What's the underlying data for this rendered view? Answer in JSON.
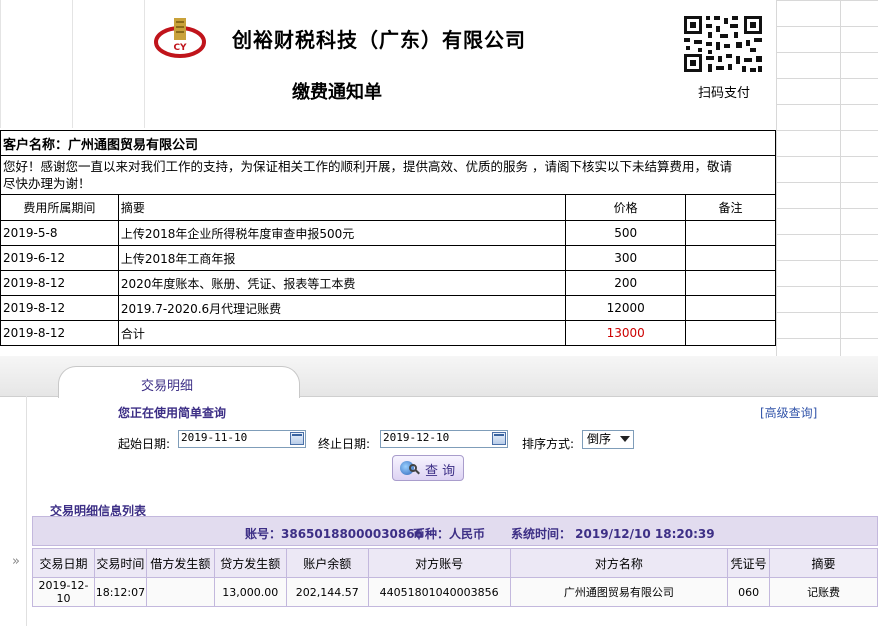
{
  "header": {
    "company": "创裕财税科技（广东）有限公司",
    "doc_title": "缴费通知单",
    "logo_text": "CY",
    "qr_label": "扫码支付"
  },
  "invoice": {
    "customer_label": "客户名称：广州通图贸易有限公司",
    "greeting_line1": "您好！感谢您一直以来对我们工作的支持，为保证相关工作的顺利开展，提供高效、优质的服务 ，请阁下核实以下未结算费用，敬请",
    "greeting_line2": "尽快办理为谢！",
    "headers": {
      "period": "费用所属期间",
      "summary": "摘要",
      "price": "价格",
      "remark": "备注"
    },
    "rows": [
      {
        "period": "2019-5-8",
        "summary": "上传2018年企业所得税年度审查申报500元",
        "price": "500",
        "remark": ""
      },
      {
        "period": "2019-6-12",
        "summary": "上传2018年工商年报",
        "price": "300",
        "remark": ""
      },
      {
        "period": "2019-8-12",
        "summary": "2020年度账本、账册、凭证、报表等工本费",
        "price": "200",
        "remark": ""
      },
      {
        "period": "2019-8-12",
        "summary": "2019.7-2020.6月代理记账费",
        "price": "12000",
        "remark": ""
      },
      {
        "period": "2019-8-12",
        "summary": "合计",
        "price": "13000",
        "remark": ""
      }
    ],
    "total_color": "#cc0000"
  },
  "bank": {
    "tab_label": "交易明细",
    "simple_query": "您正在使用简单查询",
    "advanced_query": "[高级查询]",
    "start_label": "起始日期:",
    "start_value": "2019-11-10",
    "end_label": "终止日期:",
    "end_value": "2019-12-10",
    "sort_label": "排序方式:",
    "sort_value": "倒序",
    "query_button": "查 询",
    "list_title": "交易明细信息列表",
    "account": "账号：38650188000030866",
    "currency": "币种：人民币",
    "system_time": "系统时间：  2019/12/10  18:20:39",
    "side_arrow": "»",
    "columns": [
      "交易日期",
      "交易时间",
      "借方发生额",
      "贷方发生额",
      "账户余额",
      "对方账号",
      "对方名称",
      "凭证号",
      "摘要"
    ],
    "rows": [
      [
        "2019-12-10",
        "18:12:07",
        "",
        "13,000.00",
        "202,144.57",
        "44051801040003856",
        "广州通图贸易有限公司",
        "060",
        "记账费"
      ]
    ],
    "accent_color": "#3d2f86"
  }
}
